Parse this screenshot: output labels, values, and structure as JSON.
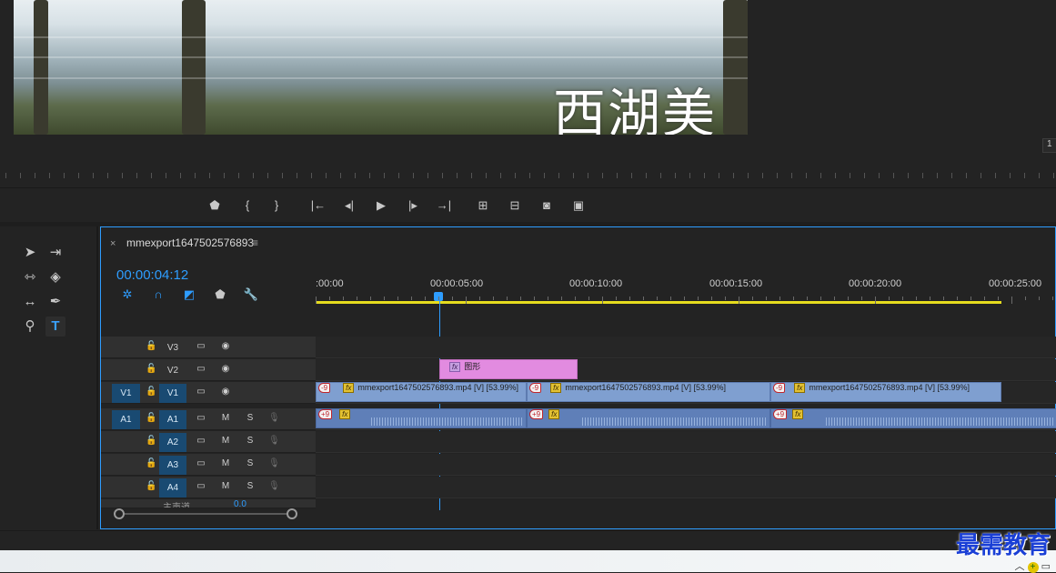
{
  "monitor": {
    "subtitle": "西湖美",
    "zoom_readout": "1"
  },
  "transport": {
    "buttons": [
      {
        "name": "marker",
        "glyph": "⬟"
      },
      {
        "name": "mark-in",
        "glyph": "{"
      },
      {
        "name": "mark-out",
        "glyph": "}"
      },
      {
        "name": "go-to-in",
        "glyph": "|←"
      },
      {
        "name": "step-back",
        "glyph": "◂|"
      },
      {
        "name": "play",
        "glyph": "▶"
      },
      {
        "name": "step-forward",
        "glyph": "|▸"
      },
      {
        "name": "go-to-out",
        "glyph": "→|"
      },
      {
        "name": "lift",
        "glyph": "⊞"
      },
      {
        "name": "extract",
        "glyph": "⊟"
      },
      {
        "name": "export-frame",
        "glyph": "◙"
      },
      {
        "name": "comparison-view",
        "glyph": "▣"
      }
    ]
  },
  "sequence": {
    "close": "×",
    "name": "mmexport1647502576893",
    "menu": "≡",
    "timecode": "00:00:04:12"
  },
  "ruler": {
    "labels": [
      ":00:00",
      "00:00:05:00",
      "00:00:10:00",
      "00:00:15:00",
      "00:00:20:00",
      "00:00:25:00"
    ]
  },
  "tracks": {
    "video": [
      {
        "name": "V3",
        "source": "",
        "targeted": false
      },
      {
        "name": "V2",
        "source": "",
        "targeted": false
      },
      {
        "name": "V1",
        "source": "V1",
        "targeted": true
      }
    ],
    "audio": [
      {
        "name": "A1",
        "source": "A1",
        "targeted": true,
        "m": "M",
        "s": "S"
      },
      {
        "name": "A2",
        "source": "",
        "targeted": true,
        "m": "M",
        "s": "S"
      },
      {
        "name": "A3",
        "source": "",
        "targeted": true,
        "m": "M",
        "s": "S"
      },
      {
        "name": "A4",
        "source": "",
        "targeted": true,
        "m": "M",
        "s": "S"
      }
    ],
    "master_label": "主声道",
    "master_value": "0.0"
  },
  "clips": {
    "graphic": {
      "fx": "fx",
      "label": "图形"
    },
    "video_clips": [
      {
        "badge": "-9",
        "fx": "fx",
        "label": "mmexport1647502576893.mp4 [V] [53.99%]"
      },
      {
        "badge": "-9",
        "fx": "fx",
        "label": "mmexport1647502576893.mp4 [V] [53.99%]"
      },
      {
        "badge": "-9",
        "fx": "fx",
        "label": "mmexport1647502576893.mp4 [V] [53.99%]"
      }
    ],
    "audio_clips": [
      {
        "badge": "+9",
        "fx": "fx"
      },
      {
        "badge": "+9",
        "fx": "fx"
      },
      {
        "badge": "+9",
        "fx": "fx"
      }
    ]
  },
  "watermark": "最需教育",
  "colors": {
    "accent": "#2e9dff",
    "video_clip": "#7f9fd0",
    "audio_clip": "#5f7fb8",
    "graphic_clip": "#e28be0",
    "work_area": "#e6dc1e"
  }
}
